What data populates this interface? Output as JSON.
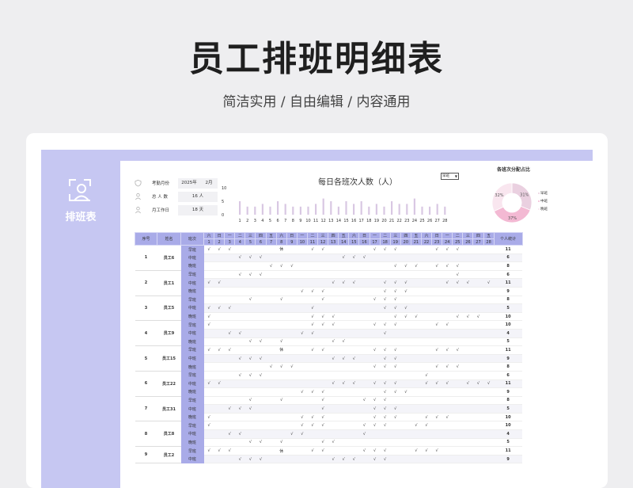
{
  "page": {
    "title": "员工排班明细表",
    "subtitle": "简洁实用 / 自由编辑 / 内容通用"
  },
  "brand": {
    "label": "排班表"
  },
  "info": {
    "month_label": "考勤月份",
    "year": "2025年",
    "month": "2月",
    "headcount_label": "总 人 数",
    "headcount": "16 人",
    "workdays_label": "月工作日",
    "workdays": "18 天"
  },
  "chart": {
    "title": "每日各班次人数（人）",
    "select_value": "早班"
  },
  "chart_data": [
    {
      "type": "bar",
      "categories": [
        "1",
        "2",
        "3",
        "4",
        "5",
        "6",
        "7",
        "8",
        "9",
        "10",
        "11",
        "12",
        "13",
        "14",
        "15",
        "16",
        "17",
        "18",
        "19",
        "20",
        "21",
        "22",
        "23",
        "24",
        "25",
        "26",
        "27",
        "28"
      ],
      "values": [
        5,
        3,
        3,
        4,
        3,
        5,
        4,
        3,
        3,
        3,
        4,
        6,
        5,
        3,
        5,
        4,
        5,
        3,
        4,
        3,
        5,
        4,
        4,
        6,
        3,
        3,
        4,
        3
      ],
      "title": "每日各班次人数（人）",
      "xlabel": "",
      "ylabel": "",
      "ylim": [
        0,
        10
      ],
      "yticks": [
        "10",
        "5",
        "0"
      ]
    },
    {
      "type": "pie",
      "title": "各班次分配占比",
      "categories": [
        "早班",
        "中班",
        "晚班"
      ],
      "values": [
        31,
        37,
        32
      ],
      "labels": [
        "31%",
        "37%",
        "32%"
      ]
    }
  ],
  "donut": {
    "title": "各班次分配占比",
    "colors": [
      "#ead0e0",
      "#f3b9d3",
      "#f9e6ef"
    ]
  },
  "table": {
    "headers": {
      "seq": "序号",
      "name": "姓名",
      "shift": "班次",
      "total": "个人统计"
    },
    "weekdays": [
      "六",
      "日",
      "一",
      "二",
      "三",
      "四",
      "五",
      "六",
      "日",
      "一",
      "二",
      "三",
      "四",
      "五",
      "六",
      "日",
      "一",
      "二",
      "三",
      "四",
      "五",
      "六",
      "日",
      "一",
      "二",
      "三",
      "四",
      "五"
    ],
    "days": [
      "1",
      "2",
      "3",
      "4",
      "5",
      "6",
      "7",
      "8",
      "9",
      "10",
      "11",
      "12",
      "13",
      "14",
      "15",
      "16",
      "17",
      "18",
      "19",
      "20",
      "21",
      "22",
      "23",
      "24",
      "25",
      "26",
      "27",
      "28"
    ],
    "groups": [
      {
        "seq": "1",
        "name": "员工6",
        "rows": [
          {
            "shift": "早班",
            "marks": "√√√    |√|  √√    √√√   √√√",
            "total": "11"
          },
          {
            "shift": "中班",
            "marks": "   √√√       √√√",
            "total": "6"
          },
          {
            "shift": "晚班",
            "marks": "      √√√         √√√ √√√",
            "total": "8"
          }
        ]
      },
      {
        "seq": "2",
        "name": "员工1",
        "rows": [
          {
            "shift": "早班",
            "marks": "   √√√                  √",
            "total": "6"
          },
          {
            "shift": "中班",
            "marks": "√√          √√√  √√√   √√√ √√√",
            "total": "11"
          },
          {
            "shift": "晚班",
            "marks": "         √√√     √√√",
            "total": "9"
          }
        ]
      },
      {
        "seq": "3",
        "name": "员工5",
        "rows": [
          {
            "shift": "早班",
            "marks": "    √  √   √    √√√",
            "total": "8"
          },
          {
            "shift": "中班",
            "marks": "√√√       √      √√√",
            "total": "5"
          },
          {
            "shift": "晚班",
            "marks": "√         √√√     √√√   √√√",
            "total": "10"
          }
        ]
      },
      {
        "seq": "4",
        "name": "员工9",
        "rows": [
          {
            "shift": "早班",
            "marks": "√         √√√   √√√   √√",
            "total": "10"
          },
          {
            "shift": "中班",
            "marks": "  √√     √√      √",
            "total": "4"
          },
          {
            "shift": "晚班",
            "marks": "    √√ √    √√",
            "total": "5"
          }
        ]
      },
      {
        "seq": "5",
        "name": "员工15",
        "rows": [
          {
            "shift": "早班",
            "marks": "√√√    |√|  √√    √√√   √√√",
            "total": "11"
          },
          {
            "shift": "中班",
            "marks": "   √√√      √√√  √√",
            "total": "9"
          },
          {
            "shift": "晚班",
            "marks": "      √√√       √√√   √√√",
            "total": "8"
          }
        ]
      },
      {
        "seq": "6",
        "name": "员工22",
        "rows": [
          {
            "shift": "早班",
            "marks": "   √√√               √",
            "total": "6"
          },
          {
            "shift": "中班",
            "marks": "√√          √√√ √√√  √√√ √√√",
            "total": "11"
          },
          {
            "shift": "晚班",
            "marks": "         √√√     √√√",
            "total": "9"
          }
        ]
      },
      {
        "seq": "7",
        "name": "员工31",
        "rows": [
          {
            "shift": "早班",
            "marks": "    √  √   √   √√√",
            "total": "8"
          },
          {
            "shift": "中班",
            "marks": "  √√√      √    √√√",
            "total": "5"
          },
          {
            "shift": "晚班",
            "marks": "√        √√√    √√√  √√√",
            "total": "10"
          }
        ]
      },
      {
        "seq": "8",
        "name": "员工8",
        "rows": [
          {
            "shift": "早班",
            "marks": "√        √√√   √√√  √√",
            "total": "10"
          },
          {
            "shift": "中班",
            "marks": "  √√    √√     √",
            "total": "4"
          },
          {
            "shift": "晚班",
            "marks": "    √√ √   √√",
            "total": "5"
          }
        ]
      },
      {
        "seq": "9",
        "name": "员工2",
        "rows": [
          {
            "shift": "早班",
            "marks": "√√√    |√|  √√   √√√  √√√",
            "total": "11"
          },
          {
            "shift": "中班",
            "marks": "   √√√      √√√ √√",
            "total": "9"
          }
        ]
      }
    ]
  }
}
